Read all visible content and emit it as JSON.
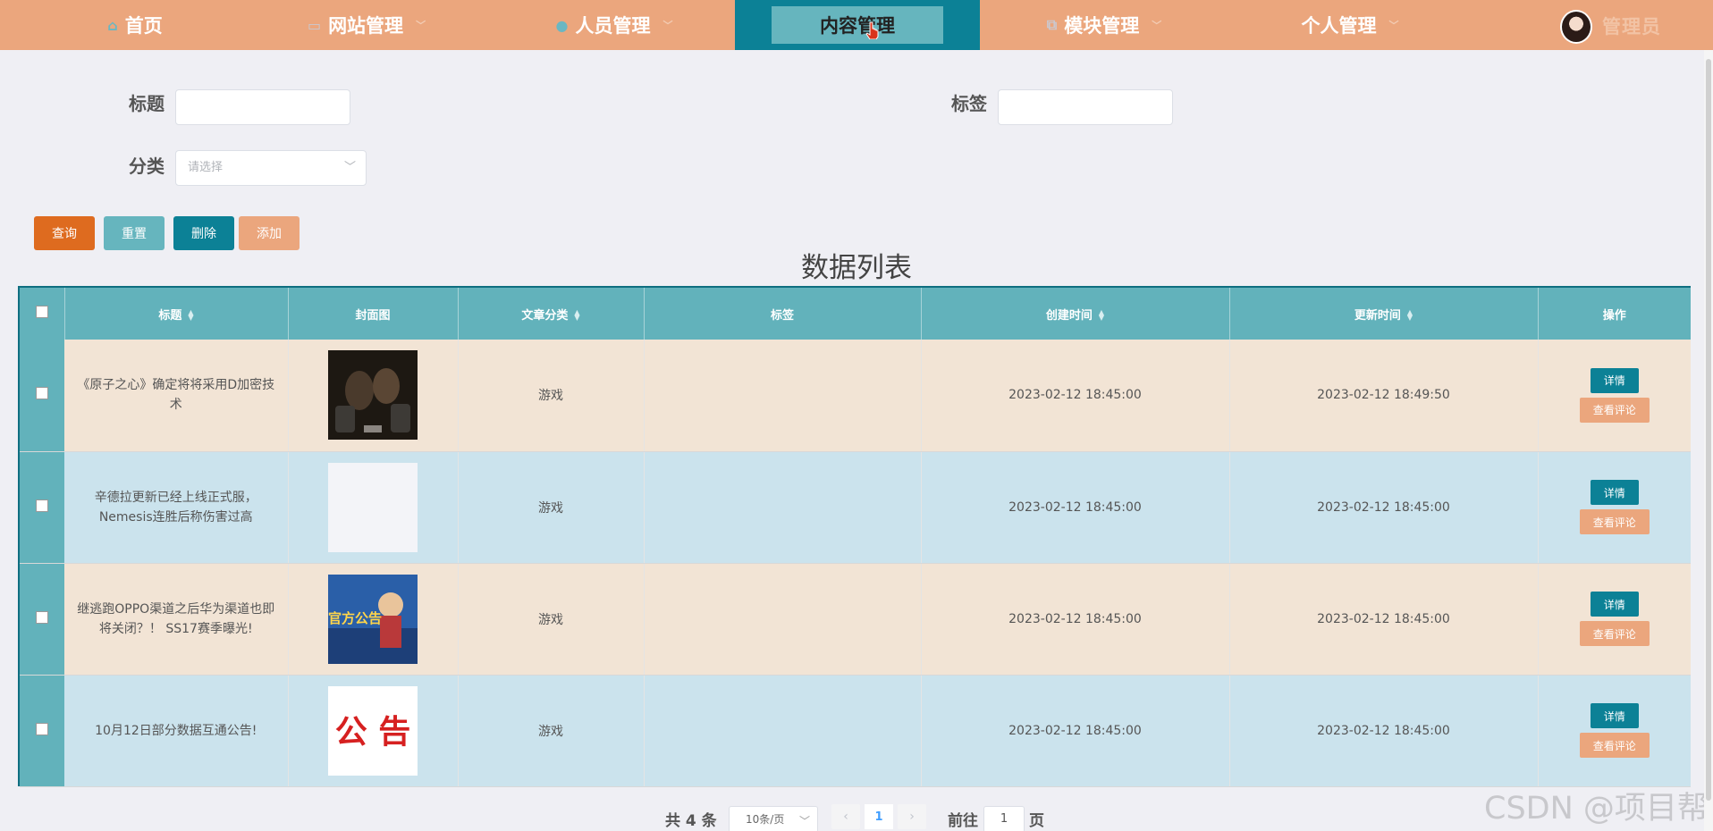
{
  "nav": {
    "items": [
      {
        "label": "首页",
        "icon": "home-icon"
      },
      {
        "label": "网站管理",
        "icon": "monitor-icon"
      },
      {
        "label": "人员管理",
        "icon": "user-icon"
      },
      {
        "label": "内容管理",
        "icon": ""
      },
      {
        "label": "模块管理",
        "icon": "layers-icon"
      },
      {
        "label": "个人管理",
        "icon": ""
      }
    ],
    "active": "内容管理",
    "username": "管理员"
  },
  "filters": {
    "title_label": "标题",
    "title_value": "",
    "tag_label": "标签",
    "tag_value": "",
    "category_label": "分类",
    "category_placeholder": "请选择"
  },
  "actions": {
    "query": "查询",
    "reset": "重置",
    "delete": "删除",
    "add": "添加"
  },
  "list_title": "数据列表",
  "table": {
    "columns": [
      "标题",
      "封面图",
      "文章分类",
      "标签",
      "创建时间",
      "更新时间",
      "操作"
    ],
    "rows": [
      {
        "title": "《原子之心》确定将将采用D加密技术",
        "category": "游戏",
        "tag": "",
        "created": "2023-02-12 18:45:00",
        "updated": "2023-02-12 18:49:50",
        "cover": "dark-robots-image"
      },
      {
        "title": "辛德拉更新已经上线正式服，Nemesis连胜后称伤害过高",
        "category": "游戏",
        "tag": "",
        "created": "2023-02-12 18:45:00",
        "updated": "2023-02-12 18:45:00",
        "cover": "blank-image"
      },
      {
        "title": "继逃跑OPPO渠道之后华为渠道也即将关闭？！ SS17赛季曝光!",
        "category": "游戏",
        "tag": "",
        "created": "2023-02-12 18:45:00",
        "updated": "2023-02-12 18:45:00",
        "cover": "announcement-poster-image"
      },
      {
        "title": "10月12日部分数据互通公告!",
        "category": "游戏",
        "tag": "",
        "created": "2023-02-12 18:45:00",
        "updated": "2023-02-12 18:45:00",
        "cover": "notice-text-image"
      }
    ],
    "detail_label": "详情",
    "comment_label": "查看评论"
  },
  "pagination": {
    "total": "共 4 条",
    "page_size": "10条/页",
    "current_page": "1",
    "goto_prefix": "前往",
    "goto_value": "1",
    "goto_suffix": "页"
  },
  "cover_texts": {
    "poster": "官方公告",
    "notice": "公 告"
  },
  "watermark": "CSDN @项目帮",
  "colors": {
    "nav_bg": "#eba67d",
    "nav_active": "#0c8196",
    "header_teal": "#62b2bb",
    "row_odd": "#f2e4d5",
    "row_even": "#cbe3ed",
    "btn_query": "#de6b1f",
    "btn_reset": "#66b5be",
    "btn_delete": "#0c8196",
    "btn_add": "#eba67d"
  }
}
